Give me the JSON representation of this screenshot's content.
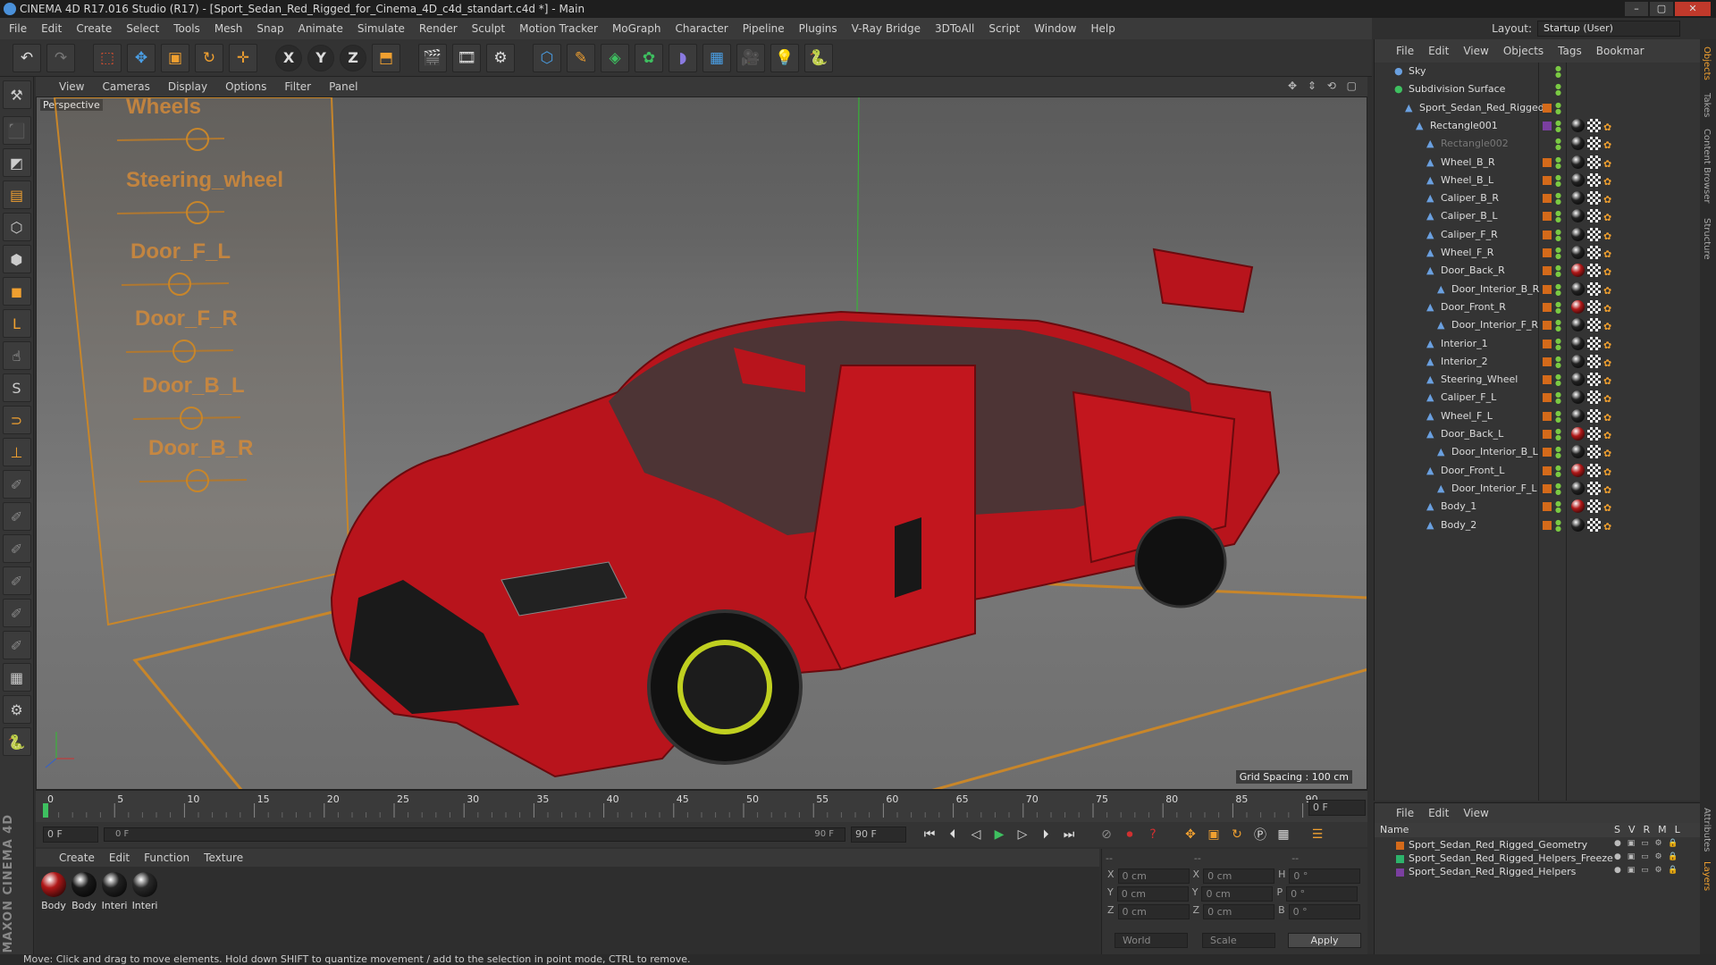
{
  "window": {
    "title": "CINEMA 4D R17.016 Studio (R17) - [Sport_Sedan_Red_Rigged_for_Cinema_4D_c4d_standart.c4d *] - Main"
  },
  "menu": [
    "File",
    "Edit",
    "Create",
    "Select",
    "Tools",
    "Mesh",
    "Snap",
    "Animate",
    "Simulate",
    "Render",
    "Sculpt",
    "Motion Tracker",
    "MoGraph",
    "Character",
    "Pipeline",
    "Plugins",
    "V-Ray Bridge",
    "3DToAll",
    "Script",
    "Window",
    "Help"
  ],
  "layout": {
    "label": "Layout:",
    "value": "Startup (User)"
  },
  "toolbar_axes": [
    "X",
    "Y",
    "Z"
  ],
  "viewport": {
    "menu": [
      "View",
      "Cameras",
      "Display",
      "Options",
      "Filter",
      "Panel"
    ],
    "label": "Perspective",
    "grid_spacing": "Grid Spacing : 100 cm",
    "sliders": [
      "Wheels",
      "Steering_wheel",
      "Door_F_L",
      "Door_F_R",
      "Door_B_L",
      "Door_B_R"
    ]
  },
  "timeline": {
    "ticks": [
      "0",
      "5",
      "10",
      "15",
      "20",
      "25",
      "30",
      "35",
      "40",
      "45",
      "50",
      "55",
      "60",
      "65",
      "70",
      "75",
      "80",
      "85",
      "90"
    ],
    "frame_field": "0 F"
  },
  "playback": {
    "start": "0 F",
    "range_start": "0 F",
    "range_end": "90 F",
    "end": "90 F"
  },
  "materials": {
    "menu": [
      "Create",
      "Edit",
      "Function",
      "Texture"
    ],
    "items": [
      {
        "label": "Body",
        "color": "#b01818"
      },
      {
        "label": "Body",
        "color": "#1a1a1a"
      },
      {
        "label": "Interi",
        "color": "#222222"
      },
      {
        "label": "Interi",
        "color": "#2a2a2a"
      }
    ]
  },
  "coords": {
    "rows": [
      {
        "a": "X",
        "av": "0 cm",
        "b": "X",
        "bv": "0 cm",
        "c": "H",
        "cv": "0 °"
      },
      {
        "a": "Y",
        "av": "0 cm",
        "b": "Y",
        "bv": "0 cm",
        "c": "P",
        "cv": "0 °"
      },
      {
        "a": "Z",
        "av": "0 cm",
        "b": "Z",
        "bv": "0 cm",
        "c": "B",
        "cv": "0 °"
      }
    ],
    "mode": "World",
    "transform": "Scale",
    "apply": "Apply"
  },
  "objects": {
    "menu": [
      "File",
      "Edit",
      "View",
      "Objects",
      "Tags",
      "Bookmar"
    ],
    "items": [
      {
        "name": "Sky",
        "indent": 0,
        "swatch": ""
      },
      {
        "name": "Subdivision Surface",
        "indent": 0,
        "swatch": ""
      },
      {
        "name": "Sport_Sedan_Red_Rigged",
        "indent": 1,
        "swatch": "#d46a1a"
      },
      {
        "name": "Rectangle001",
        "indent": 2,
        "swatch": "#7b3fa0"
      },
      {
        "name": "Rectangle002",
        "indent": 3,
        "swatch": ""
      },
      {
        "name": "Wheel_B_R",
        "indent": 3,
        "swatch": "#d46a1a"
      },
      {
        "name": "Wheel_B_L",
        "indent": 3,
        "swatch": "#d46a1a"
      },
      {
        "name": "Caliper_B_R",
        "indent": 3,
        "swatch": "#d46a1a"
      },
      {
        "name": "Caliper_B_L",
        "indent": 3,
        "swatch": "#d46a1a"
      },
      {
        "name": "Caliper_F_R",
        "indent": 3,
        "swatch": "#d46a1a"
      },
      {
        "name": "Wheel_F_R",
        "indent": 3,
        "swatch": "#d46a1a"
      },
      {
        "name": "Door_Back_R",
        "indent": 3,
        "swatch": "#d46a1a"
      },
      {
        "name": "Door_Interior_B_R",
        "indent": 4,
        "swatch": "#d46a1a"
      },
      {
        "name": "Door_Front_R",
        "indent": 3,
        "swatch": "#d46a1a"
      },
      {
        "name": "Door_Interior_F_R",
        "indent": 4,
        "swatch": "#d46a1a"
      },
      {
        "name": "Interior_1",
        "indent": 3,
        "swatch": "#d46a1a"
      },
      {
        "name": "Interior_2",
        "indent": 3,
        "swatch": "#d46a1a"
      },
      {
        "name": "Steering_Wheel",
        "indent": 3,
        "swatch": "#d46a1a"
      },
      {
        "name": "Caliper_F_L",
        "indent": 3,
        "swatch": "#d46a1a"
      },
      {
        "name": "Wheel_F_L",
        "indent": 3,
        "swatch": "#d46a1a"
      },
      {
        "name": "Door_Back_L",
        "indent": 3,
        "swatch": "#d46a1a"
      },
      {
        "name": "Door_Interior_B_L",
        "indent": 4,
        "swatch": "#d46a1a"
      },
      {
        "name": "Door_Front_L",
        "indent": 3,
        "swatch": "#d46a1a"
      },
      {
        "name": "Door_Interior_F_L",
        "indent": 4,
        "swatch": "#d46a1a"
      },
      {
        "name": "Body_1",
        "indent": 3,
        "swatch": "#d46a1a"
      },
      {
        "name": "Body_2",
        "indent": 3,
        "swatch": "#d46a1a"
      }
    ]
  },
  "layers": {
    "menu": [
      "File",
      "Edit",
      "View"
    ],
    "header": {
      "name": "Name",
      "cols": [
        "S",
        "V",
        "R",
        "M",
        "L"
      ]
    },
    "items": [
      {
        "name": "Sport_Sedan_Red_Rigged_Geometry",
        "color": "#d46a1a"
      },
      {
        "name": "Sport_Sedan_Red_Rigged_Helpers_Freeze",
        "color": "#2db36b"
      },
      {
        "name": "Sport_Sedan_Red_Rigged_Helpers",
        "color": "#7b3fa0"
      }
    ]
  },
  "side_tabs": [
    "Objects",
    "Takes",
    "Content Browser",
    "Structure"
  ],
  "side_tabs_bottom": [
    "Attributes",
    "Layers"
  ],
  "status": "Move: Click and drag to move elements. Hold down SHIFT to quantize movement / add to the selection in point mode, CTRL to remove."
}
